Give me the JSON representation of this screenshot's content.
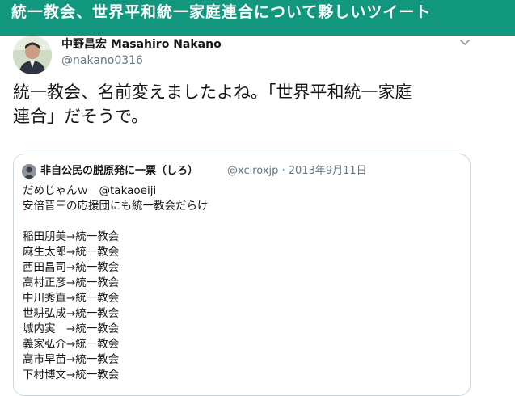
{
  "banner": {
    "title": "統一教会、世界平和統一家庭連合について夥しいツイート"
  },
  "tweet": {
    "display_name": "中野昌宏 Masahiro Nakano",
    "handle": "@nakano0316",
    "menu_icon": "chevron-down-icon",
    "body_lines": [
      "統一教会、名前変えましたよね。「世界平和統一家庭",
      "連合」だそうで。"
    ]
  },
  "quoted": {
    "display_name": "非自公民の脱原発に一票（しろ）",
    "meta": "@xciroxjp · 2013年9月11日",
    "lines": [
      "だめじゃんｗ　@takaoeiji",
      "安倍晋三の応援団にも統一教会だらけ",
      "",
      "稲田朋美→統一教会",
      "麻生太郎→統一教会",
      "西田昌司→統一教会",
      "高村正彦→統一教会",
      "中川秀直→統一教会",
      "世耕弘成→統一教会",
      "城内実　→統一教会",
      "義家弘介→統一教会",
      "高市早苗→統一教会",
      "下村博文→統一教会"
    ]
  },
  "colors": {
    "banner_bg": "#10977e",
    "text": "#14171a",
    "secondary_text": "#657786",
    "border": "#ccd6dd"
  }
}
